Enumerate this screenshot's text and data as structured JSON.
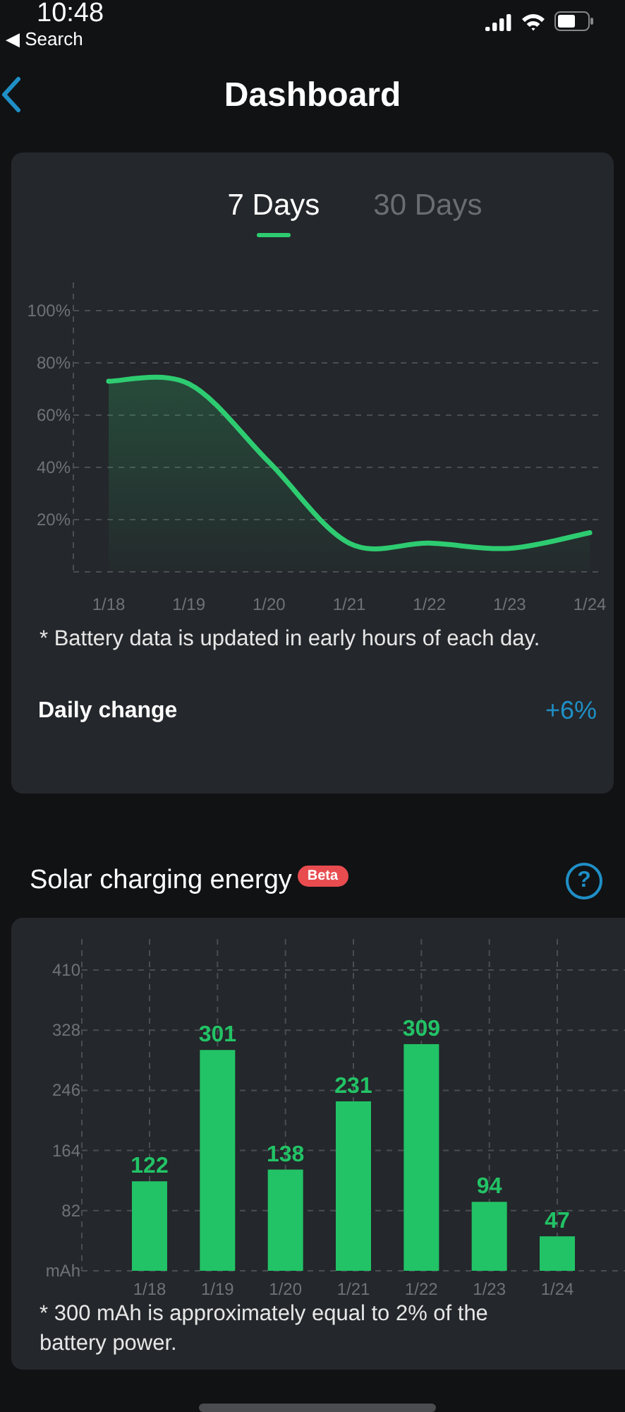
{
  "status_bar": {
    "time": "10:48",
    "back_label": "◀ Search"
  },
  "nav": {
    "title": "Dashboard"
  },
  "battery_card": {
    "tabs": [
      {
        "label": "7 Days",
        "selected": true
      },
      {
        "label": "30 Days",
        "selected": false
      }
    ],
    "chart_data": {
      "type": "area",
      "categories": [
        "1/18",
        "1/19",
        "1/20",
        "1/21",
        "1/22",
        "1/23",
        "1/24"
      ],
      "series": [
        {
          "color": "#2ecc71",
          "values": [
            73,
            72,
            42,
            11,
            11,
            9,
            15
          ]
        }
      ],
      "grid": true,
      "ylim": [
        0,
        100
      ],
      "yticks": [
        {
          "value": 20,
          "label": "20%"
        },
        {
          "value": 40,
          "label": "40%"
        },
        {
          "value": 60,
          "label": "60%"
        },
        {
          "value": 80,
          "label": "80%"
        },
        {
          "value": 100,
          "label": "100%"
        }
      ]
    },
    "note": "* Battery data is updated in early hours of each day.",
    "daily_change": {
      "label": "Daily change",
      "value": "+6%"
    }
  },
  "solar_section": {
    "title": "Solar charging energy",
    "badge": "Beta",
    "help_glyph": "?",
    "chart_data": {
      "type": "bar",
      "categories": [
        "1/18",
        "1/19",
        "1/20",
        "1/21",
        "1/22",
        "1/23",
        "1/24"
      ],
      "series": [
        {
          "color": "#22c366",
          "values": [
            122,
            301,
            138,
            231,
            309,
            94,
            47
          ]
        }
      ],
      "grid": true,
      "ylim": [
        0,
        410
      ],
      "yticks": [
        {
          "value": 0,
          "label": "mAh"
        },
        82,
        164,
        246,
        328,
        410
      ],
      "data_labels": true
    },
    "note": "* 300 mAh is approximately equal to 2% of the battery power."
  }
}
